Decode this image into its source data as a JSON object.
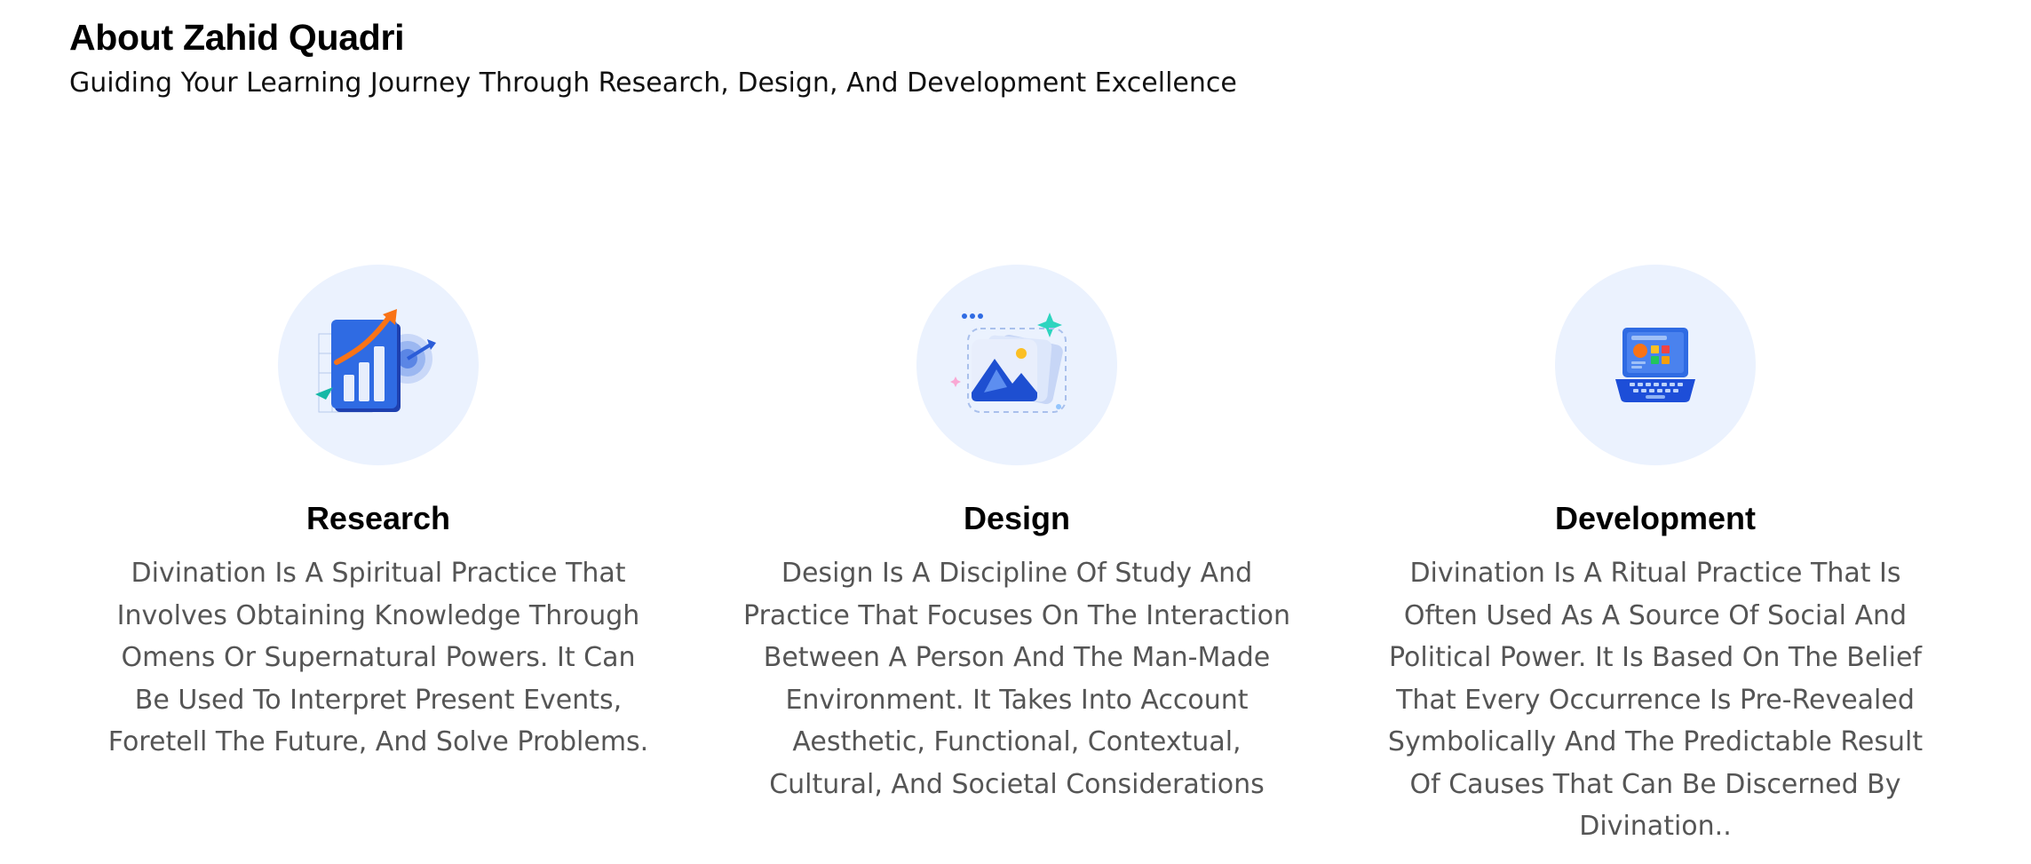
{
  "header": {
    "title": "About Zahid Quadri",
    "subtitle": "Guiding Your Learning Journey Through Research, Design, And Development Excellence"
  },
  "cards": [
    {
      "icon": "bar-chart-growth-icon",
      "title": "Research",
      "description": "Divination Is A Spiritual Practice That Involves Obtaining Knowledge Through Omens Or Supernatural Powers. It Can Be Used To Interpret Present Events, Foretell The Future, And Solve Problems."
    },
    {
      "icon": "image-gallery-icon",
      "title": "Design",
      "description": "Design Is A Discipline Of Study And Practice That Focuses On The Interaction Between A Person And The Man-Made Environment. It Takes Into Account Aesthetic, Functional, Contextual, Cultural, And Societal Considerations"
    },
    {
      "icon": "laptop-dashboard-icon",
      "title": "Development",
      "description": "Divination Is A Ritual Practice That Is Often Used As A Source Of Social And Political Power. It Is Based On The Belief That Every Occurrence Is Pre-Revealed Symbolically And The Predictable Result Of Causes That Can Be Discerned By Divination.."
    }
  ],
  "colors": {
    "icon_circle_bg": "#ebf2fe",
    "primary_blue": "#1d4ed8",
    "accent_orange": "#f97316",
    "accent_teal": "#2dd4bf",
    "description_text": "#555555"
  }
}
